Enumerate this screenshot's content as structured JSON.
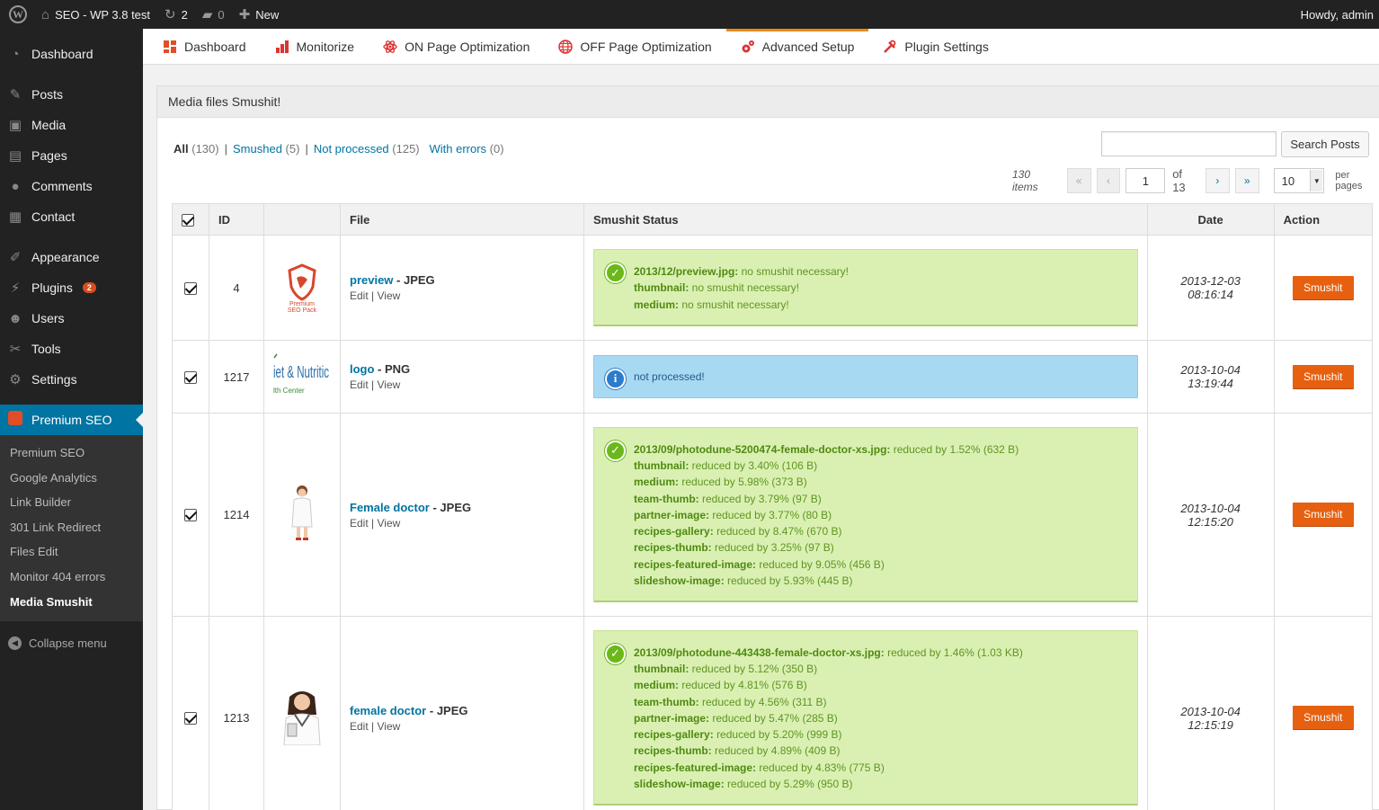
{
  "adminbar": {
    "site": "SEO - WP 3.8 test",
    "updates": "2",
    "comments": "0",
    "new": "New",
    "howdy": "Howdy, admin"
  },
  "sidebar": {
    "items": [
      {
        "label": "Dashboard",
        "icon": "dashboard-icon",
        "glyph": "◔"
      },
      {
        "label": "Posts",
        "icon": "pin-icon",
        "glyph": "✎"
      },
      {
        "label": "Media",
        "icon": "media-icon",
        "glyph": "▣"
      },
      {
        "label": "Pages",
        "icon": "pages-icon",
        "glyph": "▤"
      },
      {
        "label": "Comments",
        "icon": "comments-icon",
        "glyph": "●"
      },
      {
        "label": "Contact",
        "icon": "contact-icon",
        "glyph": "▦"
      },
      {
        "label": "Appearance",
        "icon": "brush-icon",
        "glyph": "✐"
      },
      {
        "label": "Plugins",
        "icon": "plugin-icon",
        "glyph": "⚡",
        "badge": "2"
      },
      {
        "label": "Users",
        "icon": "user-icon",
        "glyph": "☻"
      },
      {
        "label": "Tools",
        "icon": "wrench-icon",
        "glyph": "✂"
      },
      {
        "label": "Settings",
        "icon": "settings-icon",
        "glyph": "⚙"
      },
      {
        "label": "Premium SEO",
        "icon": "premium-seo-icon"
      }
    ],
    "submenu": [
      "Premium SEO",
      "Google Analytics",
      "Link Builder",
      "301 Link Redirect",
      "Files Edit",
      "Monitor 404 errors",
      "Media Smushit"
    ],
    "collapse": "Collapse menu"
  },
  "tabs": [
    {
      "label": "Dashboard",
      "icon": "dashboard-tab-icon",
      "color": "#e14d27"
    },
    {
      "label": "Monitorize",
      "icon": "bars-icon",
      "color": "#d33"
    },
    {
      "label": "ON Page Optimization",
      "icon": "atom-icon",
      "color": "#d33"
    },
    {
      "label": "OFF Page Optimization",
      "icon": "globe-icon",
      "color": "#d33"
    },
    {
      "label": "Advanced Setup",
      "icon": "gears-icon",
      "color": "#d33"
    },
    {
      "label": "Plugin Settings",
      "icon": "tools-icon",
      "color": "#d33"
    }
  ],
  "panel": {
    "title": "Media files Smushit!",
    "filters": {
      "all": "All",
      "all_count": "(130)",
      "smushed": "Smushed",
      "smushed_count": "(5)",
      "not_processed": "Not processed",
      "not_processed_count": "(125)",
      "errors": "With errors",
      "errors_count": "(0)"
    },
    "search_placeholder": "",
    "search_button": "Search Posts",
    "pager": {
      "items": "130 items",
      "current": "1",
      "of": "of 13",
      "per_page": "10",
      "per_page_label": "per pages",
      "first": "«",
      "prev": "‹",
      "next": "›",
      "last": "»"
    },
    "columns": [
      "ID",
      "File",
      "Smushit Status",
      "Date",
      "Action"
    ],
    "rows": [
      {
        "id": "4",
        "name": "preview",
        "type": "JPEG",
        "thumb": "premium-seo-pack",
        "status_type": "ok",
        "lines": [
          {
            "k": "2013/12/preview.jpg:",
            "v": "no smushit necessary!"
          },
          {
            "k": "thumbnail:",
            "v": "no smushit necessary!"
          },
          {
            "k": "medium:",
            "v": "no smushit necessary!"
          }
        ],
        "date": "2013-12-03 08:16:14"
      },
      {
        "id": "1217",
        "name": "logo",
        "type": "PNG",
        "thumb": "diet-nutrition-logo",
        "status_type": "info",
        "lines": [
          {
            "k": "",
            "v": "not processed!"
          }
        ],
        "date": "2013-10-04 13:19:44"
      },
      {
        "id": "1214",
        "name": "Female doctor",
        "type": "JPEG",
        "thumb": "female-doctor-small",
        "status_type": "ok",
        "lines": [
          {
            "k": "2013/09/photodune-5200474-female-doctor-xs.jpg:",
            "v": "reduced by 1.52% (632 B)"
          },
          {
            "k": "thumbnail:",
            "v": "reduced by 3.40% (106 B)"
          },
          {
            "k": "medium:",
            "v": "reduced by 5.98% (373 B)"
          },
          {
            "k": "team-thumb:",
            "v": "reduced by 3.79% (97 B)"
          },
          {
            "k": "partner-image:",
            "v": "reduced by 3.77% (80 B)"
          },
          {
            "k": "recipes-gallery:",
            "v": "reduced by 8.47% (670 B)"
          },
          {
            "k": "recipes-thumb:",
            "v": "reduced by 3.25% (97 B)"
          },
          {
            "k": "recipes-featured-image:",
            "v": "reduced by 9.05% (456 B)"
          },
          {
            "k": "slideshow-image:",
            "v": "reduced by 5.93% (445 B)"
          }
        ],
        "date": "2013-10-04 12:15:20"
      },
      {
        "id": "1213",
        "name": "female doctor",
        "type": "JPEG",
        "thumb": "female-doctor",
        "status_type": "ok",
        "lines": [
          {
            "k": "2013/09/photodune-443438-female-doctor-xs.jpg:",
            "v": "reduced by 1.46% (1.03 KB)"
          },
          {
            "k": "thumbnail:",
            "v": "reduced by 5.12% (350 B)"
          },
          {
            "k": "medium:",
            "v": "reduced by 4.81% (576 B)"
          },
          {
            "k": "team-thumb:",
            "v": "reduced by 4.56% (311 B)"
          },
          {
            "k": "partner-image:",
            "v": "reduced by 5.47% (285 B)"
          },
          {
            "k": "recipes-gallery:",
            "v": "reduced by 5.20% (999 B)"
          },
          {
            "k": "recipes-thumb:",
            "v": "reduced by 4.89% (409 B)"
          },
          {
            "k": "recipes-featured-image:",
            "v": "reduced by 4.83% (775 B)"
          },
          {
            "k": "slideshow-image:",
            "v": "reduced by 5.29% (950 B)"
          }
        ],
        "date": "2013-10-04 12:15:19"
      }
    ],
    "row_actions": {
      "edit": "Edit",
      "view": "View",
      "sep": "|"
    },
    "action_label": "Smushit",
    "type_sep": " - ",
    "thumb_text": {
      "preview_brand": "Premium",
      "preview_sub": "SEO Pack",
      "logo_main": "iet & Nutritic",
      "logo_sub": "lth Center"
    }
  },
  "colors": {
    "accent": "#0074a2",
    "button": "#e6600f",
    "ok_bg": "#daf0b3",
    "info_bg": "#a8d9f3",
    "sidebar": "#222222"
  }
}
